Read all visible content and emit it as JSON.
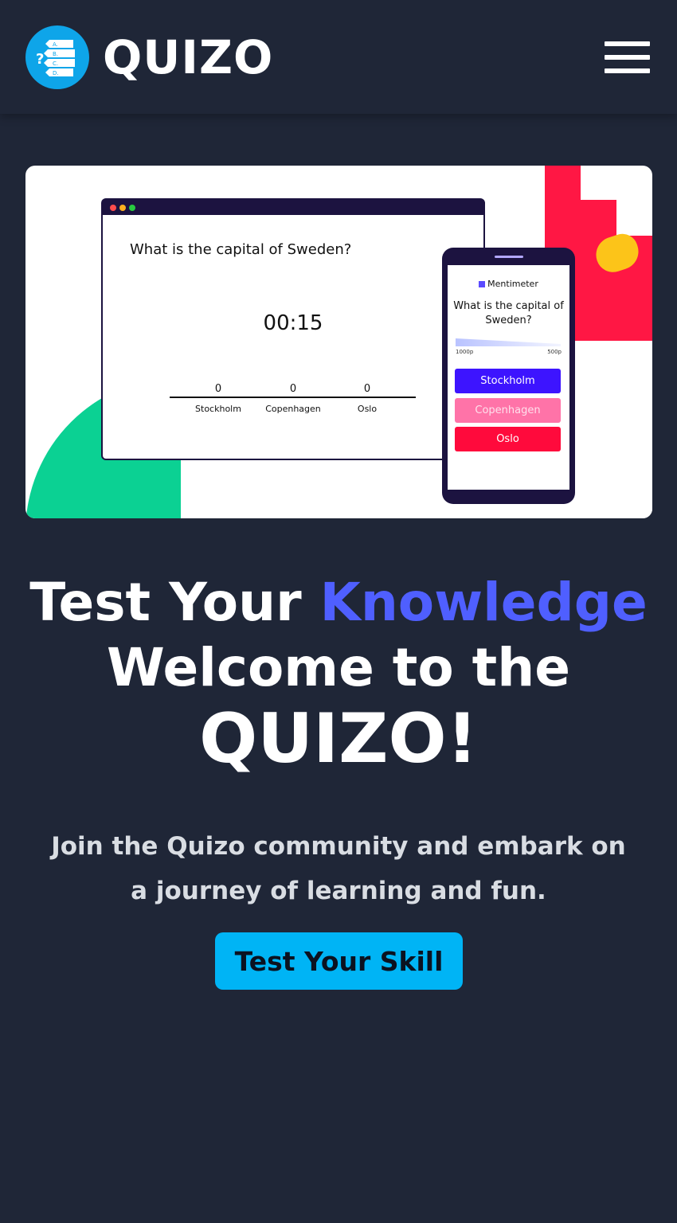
{
  "header": {
    "brand": "QUIZO",
    "logo_icon": "quiz-checklist-icon",
    "logo_letters": [
      "A.",
      "B.",
      "C.",
      "D."
    ],
    "menu_icon": "hamburger-menu-icon"
  },
  "hero_image": {
    "browser": {
      "question": "What is the capital of Sweden?",
      "timer": "00:15",
      "options": [
        {
          "label": "Stockholm",
          "count": "0"
        },
        {
          "label": "Copenhagen",
          "count": "0"
        },
        {
          "label": "Oslo",
          "count": "0"
        }
      ]
    },
    "phone": {
      "brand": "Mentimeter",
      "question": "What is the capital of Sweden?",
      "points_left": "1000p",
      "points_right": "500p",
      "options": [
        {
          "label": "Stockholm",
          "color": "#3d14ff"
        },
        {
          "label": "Copenhagen",
          "color": "#ff73a8"
        },
        {
          "label": "Oslo",
          "color": "#ff0a3c"
        }
      ]
    },
    "colors": {
      "green": "#0bd193",
      "red": "#ff1744",
      "hand": "#fcc419"
    }
  },
  "hero": {
    "line1_prefix": "Test Your",
    "line1_accent": "Knowledge",
    "line2": "Welcome to the",
    "line3": "QUIZO!",
    "subtitle": "Join the Quizo community and embark on a journey of learning and fun.",
    "cta_label": "Test Your Skill"
  },
  "colors": {
    "background": "#1f2637",
    "accent": "#4f5fff",
    "cta": "#00b4f5"
  }
}
